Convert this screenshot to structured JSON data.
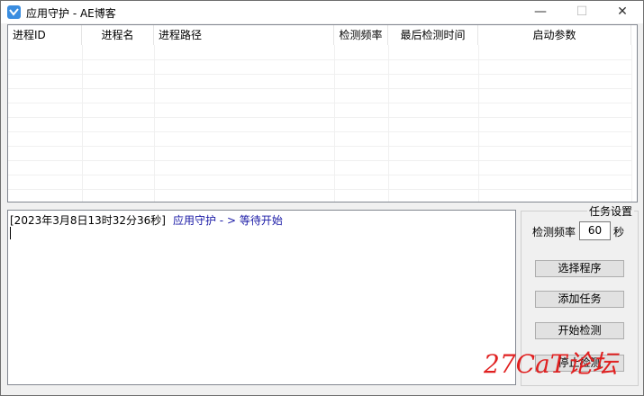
{
  "window": {
    "title": "应用守护 - AE博客",
    "minimize": "—",
    "maximize": "☐",
    "close": "✕"
  },
  "table": {
    "columns": [
      "进程ID",
      "进程名",
      "进程路径",
      "检测频率",
      "最后检测时间",
      "启动参数"
    ]
  },
  "log": {
    "time": "[2023年3月8日13时32分36秒]",
    "message": "应用守护 - > 等待开始"
  },
  "task_settings": {
    "title": "任务设置",
    "frequency_label": "检测频率",
    "frequency_value": "60",
    "frequency_unit": "秒",
    "buttons": [
      "选择程序",
      "添加任务",
      "开始检测",
      "停止检测"
    ]
  },
  "watermark": "27CaT论坛",
  "colors": {
    "accent": "#3a8de0",
    "log_message": "#1a1aa6",
    "watermark": "#e02020"
  }
}
